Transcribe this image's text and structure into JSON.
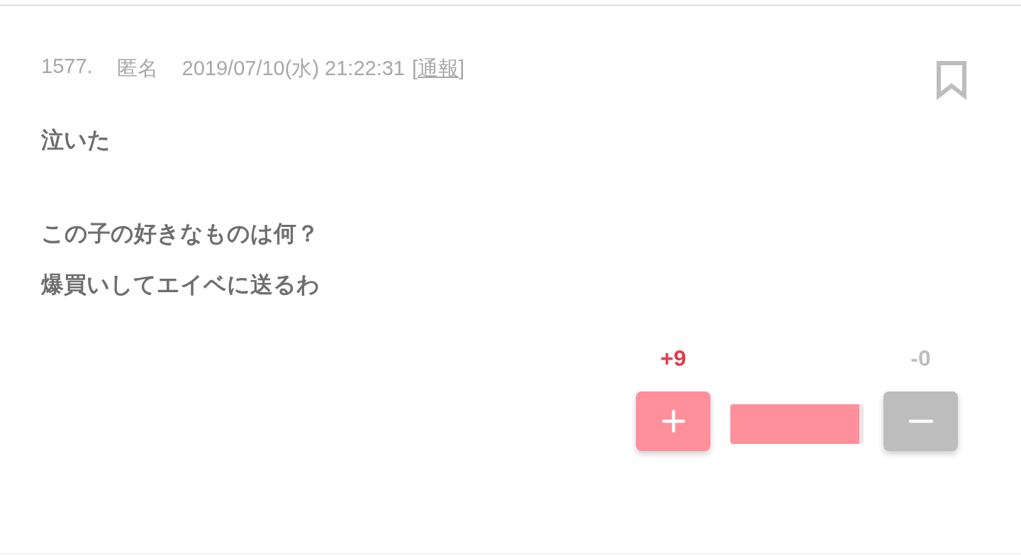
{
  "comment": {
    "number": "1577.",
    "author": "匿名",
    "datetime": "2019/07/10(水) 21:22:31",
    "report": {
      "open": "[",
      "label": "通報",
      "close": "]"
    },
    "bookmarked": false,
    "paragraphs": [
      [
        "泣いた"
      ],
      [
        "この子の好きなものは何？",
        "爆買いしてエイベに送るわ"
      ]
    ],
    "votes": {
      "plus_count": "+9",
      "minus_count": "-0",
      "level": 0.97
    }
  }
}
